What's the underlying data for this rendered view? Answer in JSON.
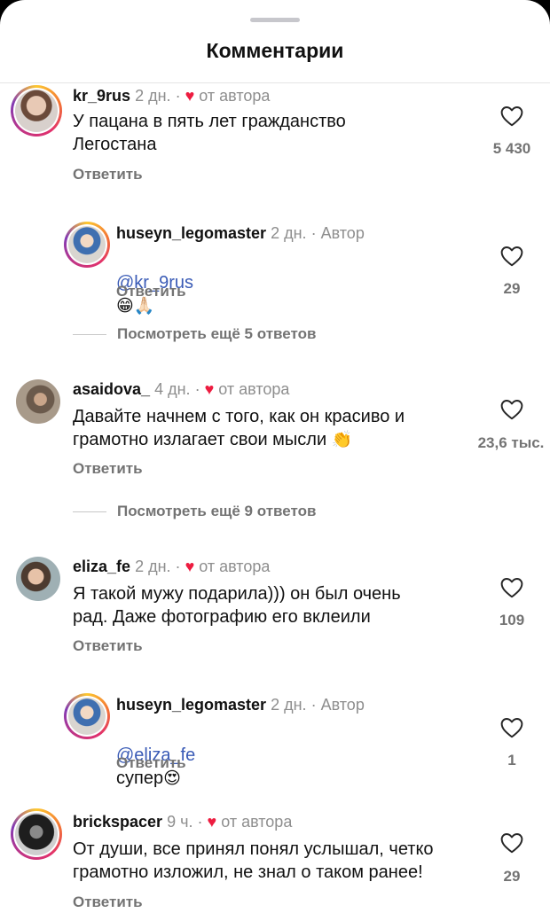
{
  "header": {
    "title": "Комментарии"
  },
  "comments": [
    {
      "username": "kr_9rus",
      "time": "2 дн.",
      "dot": "·",
      "badge": "от автора",
      "text": "У пацана в пять лет гражданство\nЛегостана",
      "reply": "Ответить",
      "likes": "5 430"
    },
    {
      "username": "huseyn_legomaster",
      "time": "2 дн.",
      "dot": "·",
      "badge": "Автор",
      "mention": "@kr_9rus",
      "text": "",
      "emoji": "😁🙏🏻",
      "reply": "Ответить",
      "likes": "29"
    },
    {
      "username": "asaidova_",
      "time": "4 дн.",
      "dot": "·",
      "badge": "от автора",
      "text": "Давайте начнем с того, как он красиво и\nграмотно излагает свои мысли",
      "emoji": "👏",
      "reply": "Ответить",
      "likes": "23,6 тыс."
    },
    {
      "username": "eliza_fe",
      "time": "2 дн.",
      "dot": "·",
      "badge": "от автора",
      "text": "Я такой мужу подарила))) он был очень\nрад. Даже фотографию его вклеили",
      "reply": "Ответить",
      "likes": "109"
    },
    {
      "username": "huseyn_legomaster",
      "time": "2 дн.",
      "dot": "·",
      "badge": "Автор",
      "mention": "@eliza_fe",
      "text": "супер",
      "emoji": "😍",
      "reply": "Ответить",
      "likes": "1"
    },
    {
      "username": "brickspacer",
      "time": "9 ч.",
      "dot": "·",
      "badge": "от автора",
      "text": "От души, все принял понял услышал, четко\nграмотно изложил, не знал о таком ранее!",
      "reply": "Ответить",
      "likes": "29"
    }
  ],
  "view_more": [
    {
      "label": "Посмотреть ещё 5 ответов"
    },
    {
      "label": "Посмотреть ещё 9 ответов"
    }
  ],
  "icons": {
    "heart_outline": "heart-outline-icon",
    "author_heart": "heart-filled-icon"
  },
  "colors": {
    "author_heart": "#ed1c40",
    "mention": "#3a5bb6",
    "muted": "#737373"
  }
}
